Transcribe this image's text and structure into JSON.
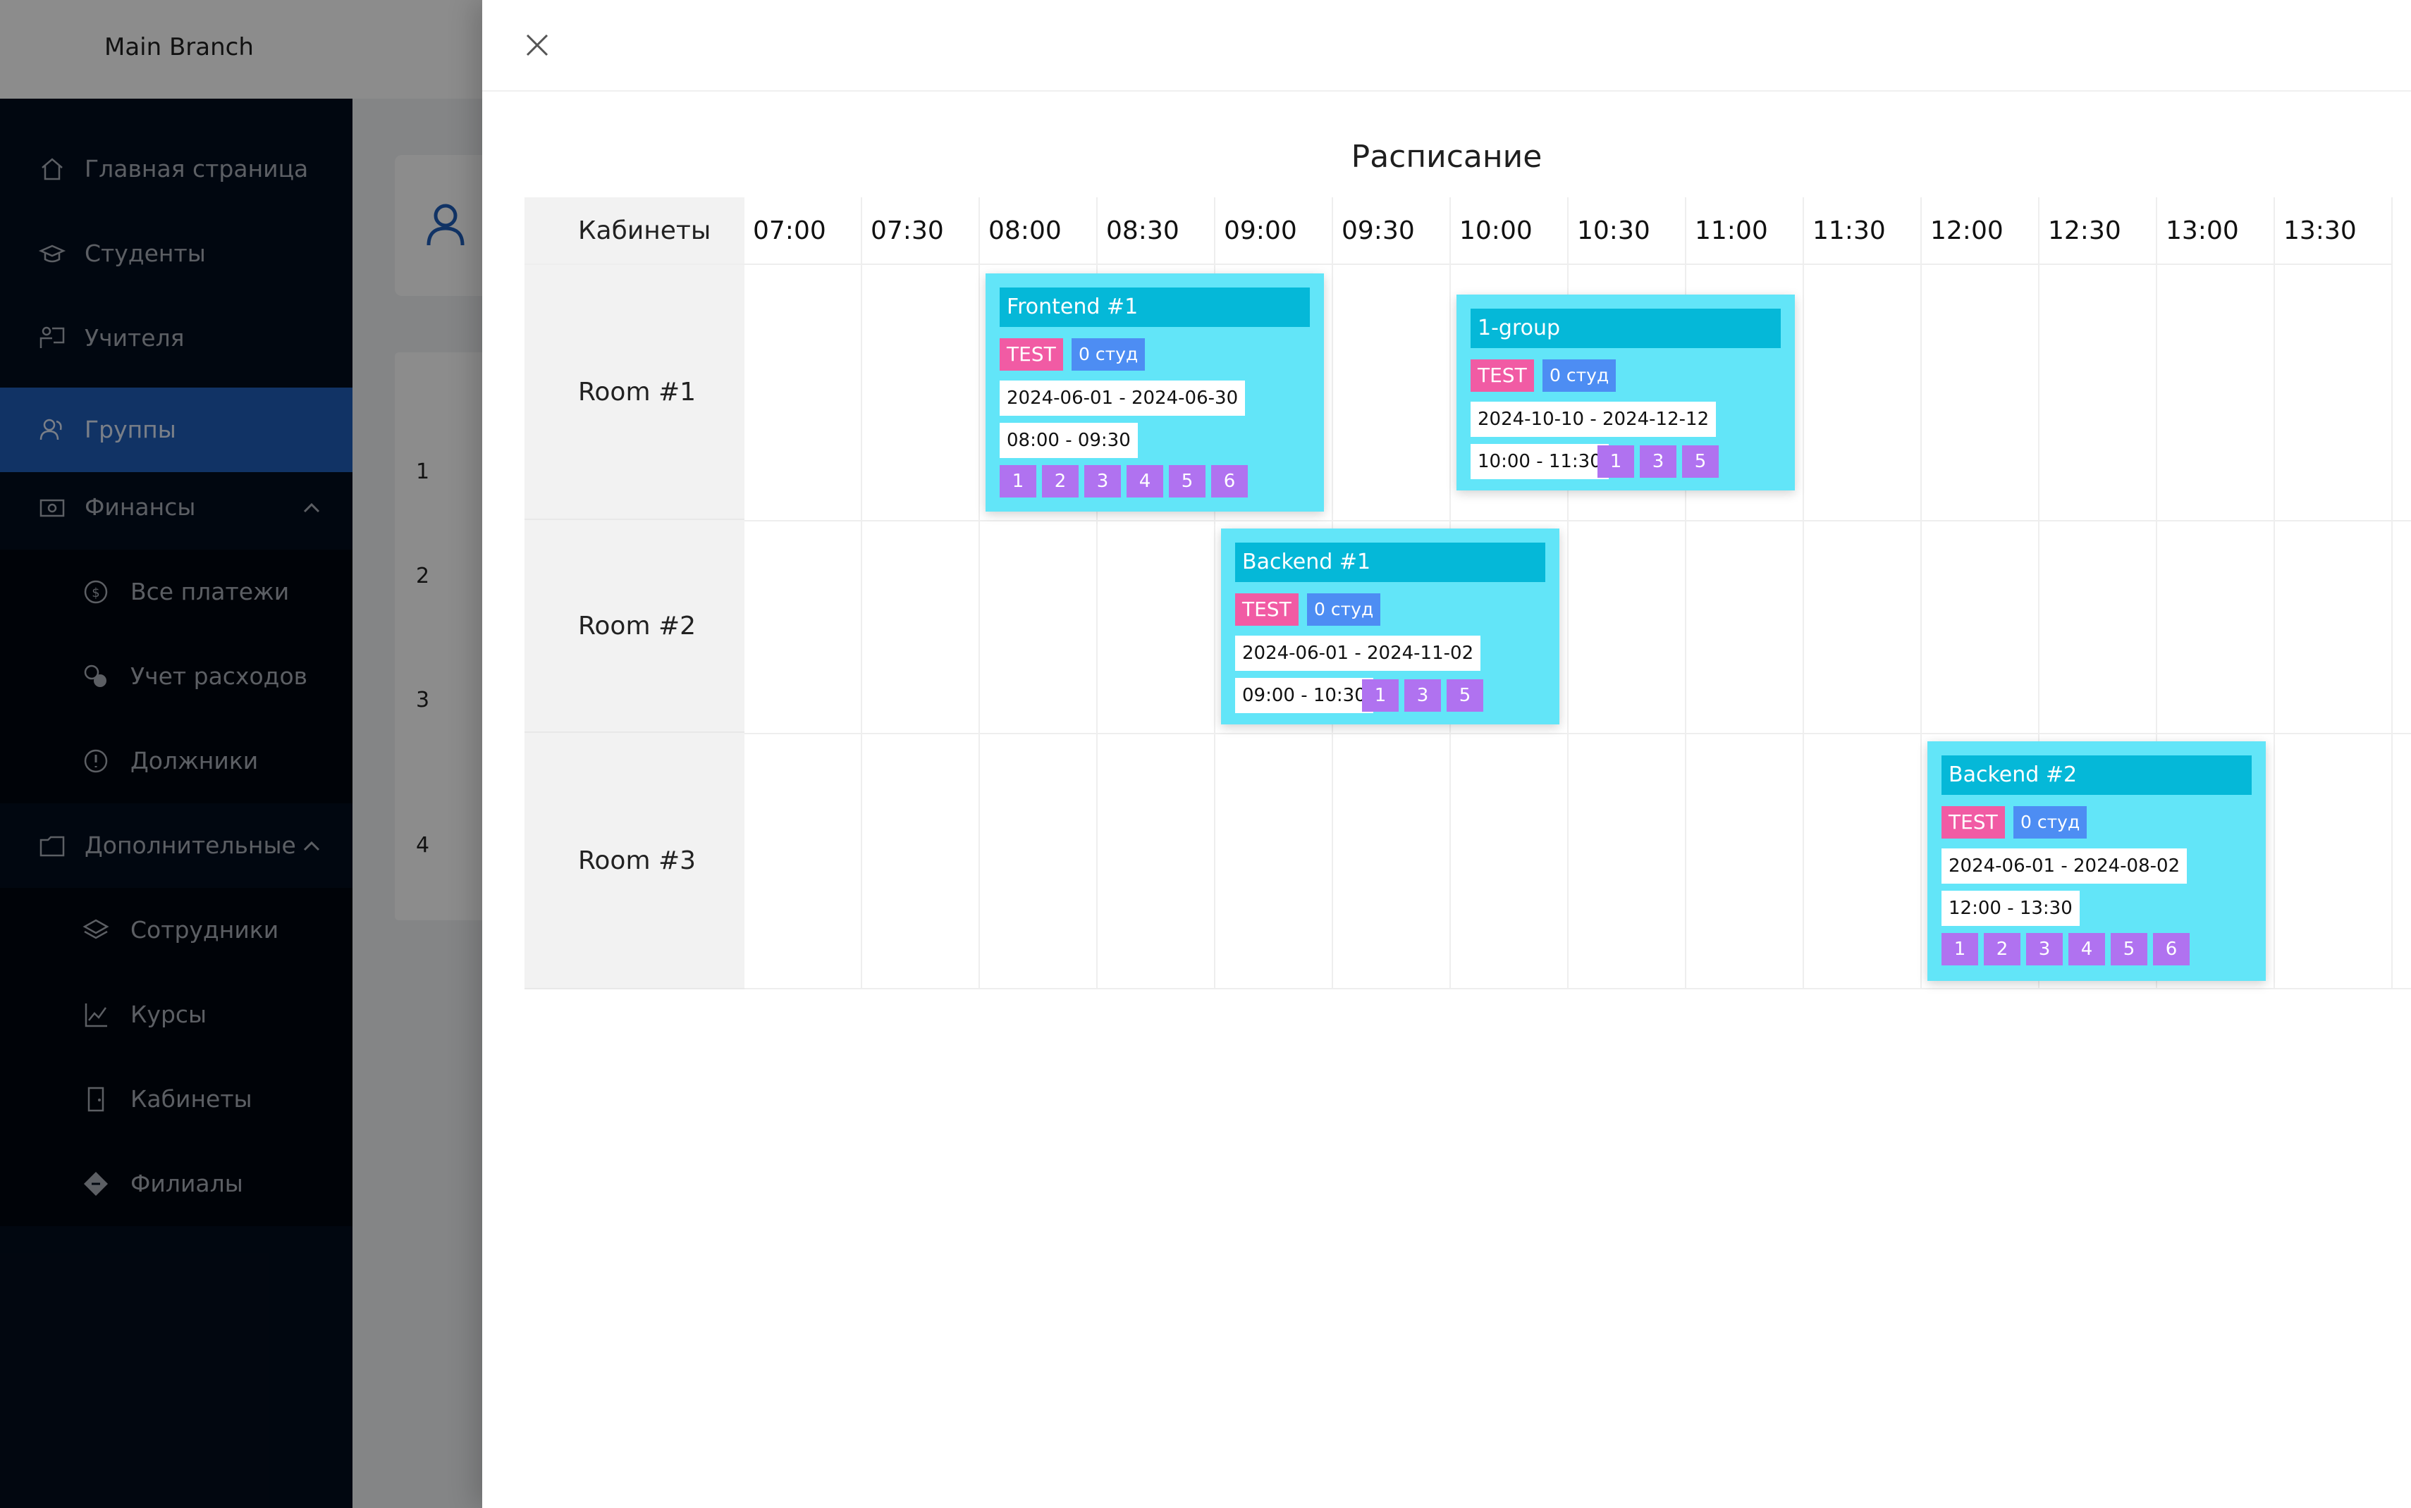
{
  "branch": {
    "name": "Main Branch"
  },
  "sidebar": {
    "items": [
      {
        "label": "Главная страница",
        "icon": "home-icon"
      },
      {
        "label": "Студенты",
        "icon": "graduation-cap-icon"
      },
      {
        "label": "Учителя",
        "icon": "teacher-icon"
      },
      {
        "label": "Группы",
        "icon": "users-icon",
        "active": true
      },
      {
        "label": "Финансы",
        "icon": "money-icon"
      },
      {
        "label": "Все платежи",
        "icon": "dollar-coin-icon"
      },
      {
        "label": "Учет расходов",
        "icon": "coins-icon"
      },
      {
        "label": "Должники",
        "icon": "alert-circle-icon"
      },
      {
        "label": "Дополнительные",
        "icon": "folder-icon"
      },
      {
        "label": "Сотрудники",
        "icon": "layers-icon"
      },
      {
        "label": "Курсы",
        "icon": "chart-book-icon"
      },
      {
        "label": "Кабинеты",
        "icon": "door-icon"
      },
      {
        "label": "Филиалы",
        "icon": "diamond-icon"
      }
    ]
  },
  "background_table": {
    "row_numbers": [
      "1",
      "2",
      "3",
      "4"
    ]
  },
  "drawer": {
    "title": "Расписание",
    "rooms_header": "Кабинеты",
    "times": [
      "07:00",
      "07:30",
      "08:00",
      "08:30",
      "09:00",
      "09:30",
      "10:00",
      "10:30",
      "11:00",
      "11:30",
      "12:00",
      "12:30",
      "13:00",
      "13:30"
    ],
    "rooms": [
      "Room #1",
      "Room #2",
      "Room #3"
    ],
    "lessons": [
      {
        "title": "Frontend #1",
        "tag": "TEST",
        "students": "0 студ",
        "dates": "2024-06-01 - 2024-06-30",
        "time": "08:00 - 09:30",
        "days": [
          "1",
          "2",
          "3",
          "4",
          "5",
          "6"
        ]
      },
      {
        "title": "1-group",
        "tag": "TEST",
        "students": "0 студ",
        "dates": "2024-10-10 - 2024-12-12",
        "time": "10:00 - 11:30",
        "days": [
          "1",
          "3",
          "5"
        ]
      },
      {
        "title": "Backend #1",
        "tag": "TEST",
        "students": "0 студ",
        "dates": "2024-06-01 - 2024-11-02",
        "time": "09:00 - 10:30",
        "days": [
          "1",
          "3",
          "5"
        ]
      },
      {
        "title": "Backend #2",
        "tag": "TEST",
        "students": "0 студ",
        "dates": "2024-06-01 - 2024-08-02",
        "time": "12:00 - 13:30",
        "days": [
          "1",
          "2",
          "3",
          "4",
          "5",
          "6"
        ]
      }
    ]
  },
  "colors": {
    "sidebar_bg": "#030d1e",
    "active_item": "#1f5eb8",
    "lesson_bg": "#62e5f8",
    "lesson_title": "#05b8d8",
    "tag_test": "#f15ba4",
    "tag_count": "#4d8df3",
    "day_badge": "#b072f0"
  }
}
